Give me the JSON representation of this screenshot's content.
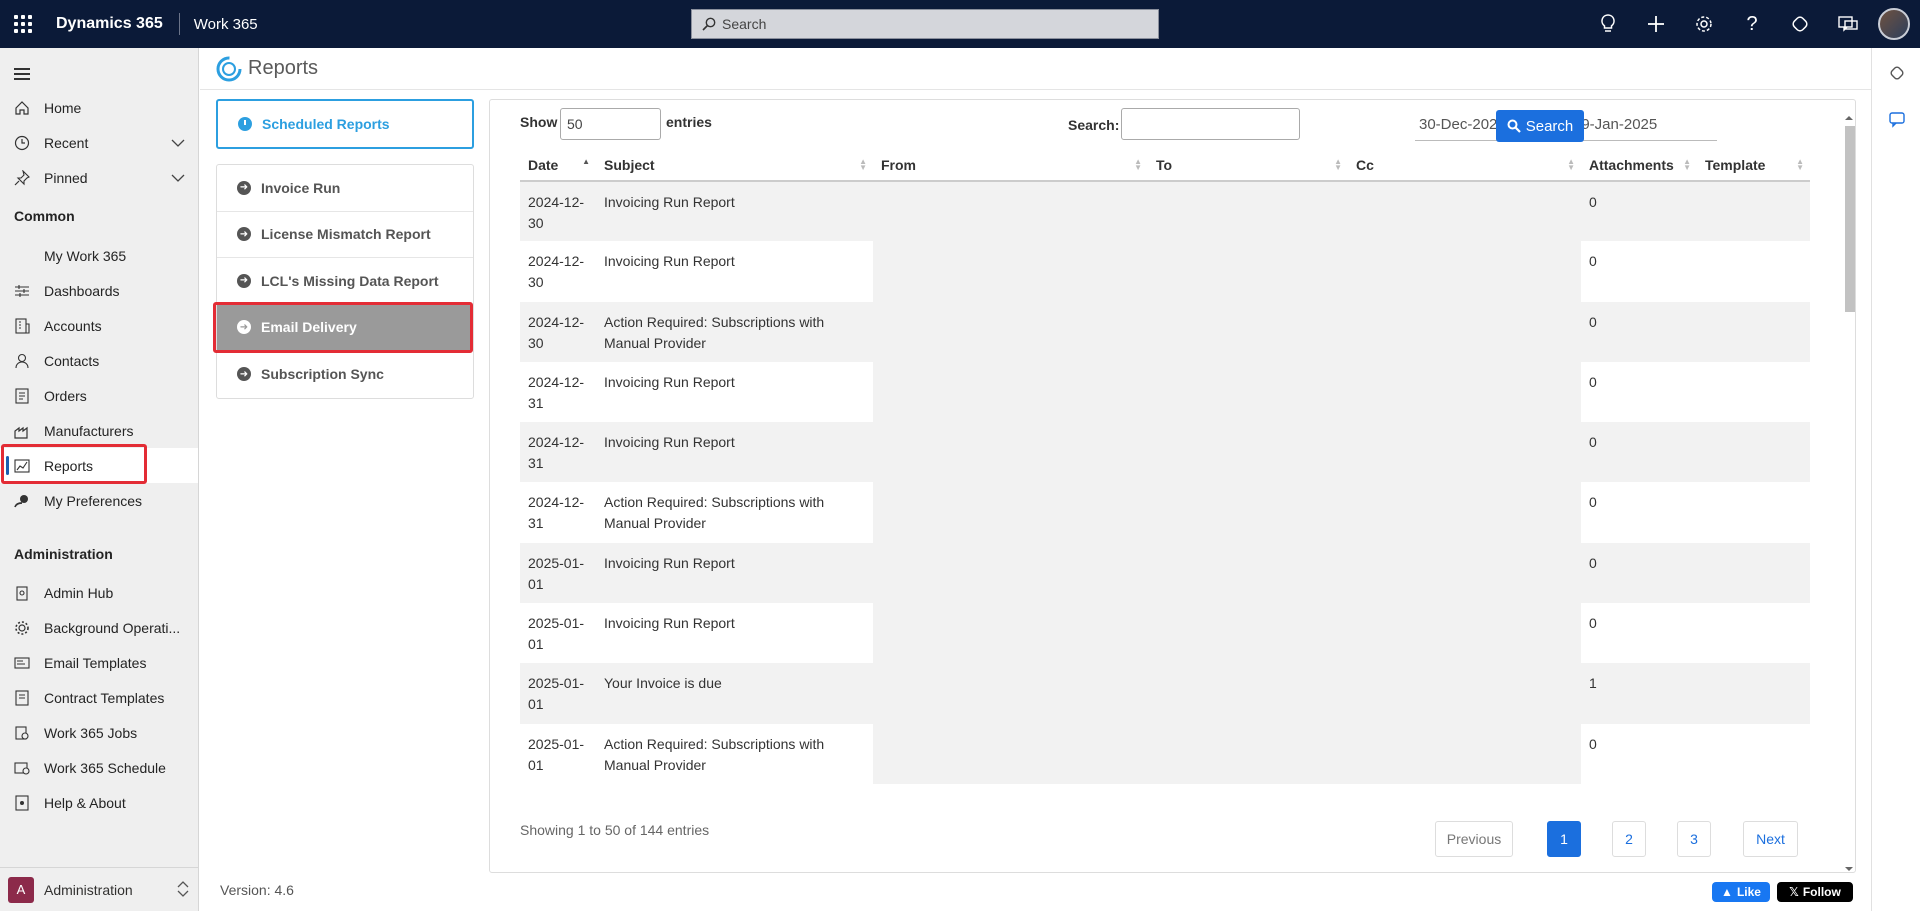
{
  "topbar": {
    "brand": "Dynamics 365",
    "app": "Work 365",
    "search_placeholder": "Search"
  },
  "nav": {
    "home": "Home",
    "recent": "Recent",
    "pinned": "Pinned",
    "section_common": "Common",
    "common": [
      "My Work 365",
      "Dashboards",
      "Accounts",
      "Contacts",
      "Orders",
      "Manufacturers",
      "Reports",
      "My Preferences"
    ],
    "section_admin": "Administration",
    "admin": [
      "Admin Hub",
      "Background Operati...",
      "Email Templates",
      "Contract Templates",
      "Work 365 Jobs",
      "Work 365 Schedule",
      "Help & About"
    ],
    "area_badge": "A",
    "area_label": "Administration"
  },
  "page": {
    "title": "Reports",
    "version": "Version: 4.6"
  },
  "reports_menu": {
    "scheduled": "Scheduled Reports",
    "items": [
      "Invoice Run",
      "License Mismatch Report",
      "LCL's Missing Data Report",
      "Email Delivery",
      "Subscription Sync"
    ],
    "selected": "Email Delivery"
  },
  "controls": {
    "show_label": "Show",
    "show_value": "50",
    "entries_label": "entries",
    "search_label": "Search:",
    "date_from": "30-Dec-2024",
    "date_to": "29-Jan-2025",
    "search_button": "Search"
  },
  "table": {
    "columns": [
      "Date",
      "Subject",
      "From",
      "To",
      "Cc",
      "Attachments",
      "Template"
    ],
    "rows": [
      {
        "date": "2024-12-30",
        "subject": "Invoicing Run Report",
        "attachments": "0"
      },
      {
        "date": "2024-12-30",
        "subject": "Invoicing Run Report",
        "attachments": "0"
      },
      {
        "date": "2024-12-30",
        "subject": "Action Required: Subscriptions with Manual Provider",
        "attachments": "0"
      },
      {
        "date": "2024-12-31",
        "subject": "Invoicing Run Report",
        "attachments": "0"
      },
      {
        "date": "2024-12-31",
        "subject": "Invoicing Run Report",
        "attachments": "0"
      },
      {
        "date": "2024-12-31",
        "subject": "Action Required: Subscriptions with Manual Provider",
        "attachments": "0"
      },
      {
        "date": "2025-01-01",
        "subject": "Invoicing Run Report",
        "attachments": "0"
      },
      {
        "date": "2025-01-01",
        "subject": "Invoicing Run Report",
        "attachments": "0"
      },
      {
        "date": "2025-01-01",
        "subject": "Your Invoice is due",
        "attachments": "1"
      },
      {
        "date": "2025-01-01",
        "subject": "Action Required: Subscriptions with Manual Provider",
        "attachments": "0"
      }
    ]
  },
  "footer": {
    "info": "Showing 1 to 50 of 144 entries",
    "previous": "Previous",
    "pages": [
      "1",
      "2",
      "3"
    ],
    "current_page": "1",
    "next": "Next",
    "like": "Like",
    "follow": "Follow"
  }
}
